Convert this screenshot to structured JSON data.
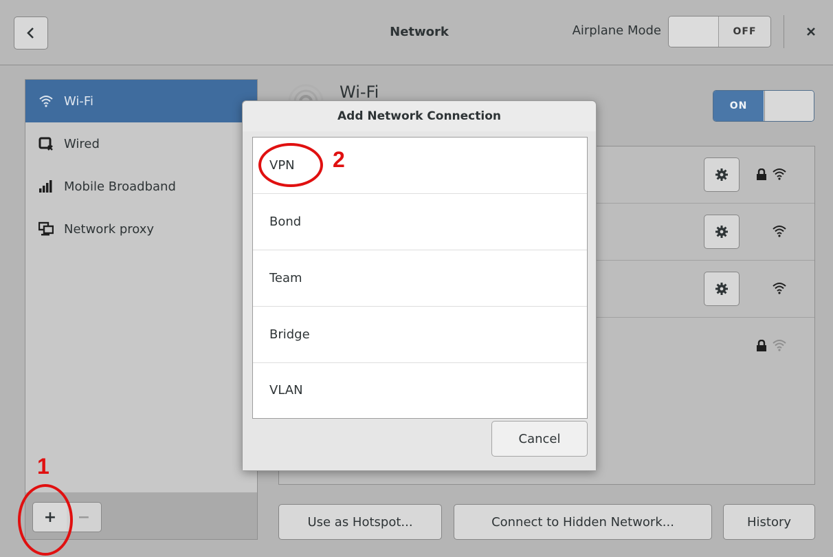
{
  "header": {
    "title": "Network",
    "airplane_label": "Airplane Mode",
    "airplane_state": "OFF"
  },
  "sidebar": {
    "items": [
      {
        "label": "Wi-Fi",
        "icon": "wifi-icon",
        "selected": true
      },
      {
        "label": "Wired",
        "icon": "wired-icon"
      },
      {
        "label": "Mobile Broadband",
        "icon": "signal-bars-icon"
      },
      {
        "label": "Network proxy",
        "icon": "proxy-icon"
      }
    ],
    "add_label": "+",
    "remove_label": "−"
  },
  "wifi_panel": {
    "title": "Wi-Fi",
    "power_state": "ON",
    "networks": [
      {
        "locked": true,
        "has_settings": true
      },
      {
        "locked": false,
        "has_settings": true
      },
      {
        "locked": false,
        "has_settings": true
      },
      {
        "locked": true,
        "has_settings": false,
        "weak": true
      }
    ]
  },
  "actions": {
    "hotspot": "Use as Hotspot...",
    "hidden": "Connect to Hidden Network...",
    "history": "History"
  },
  "dialog": {
    "title": "Add Network Connection",
    "options": [
      "VPN",
      "Bond",
      "Team",
      "Bridge",
      "VLAN"
    ],
    "cancel": "Cancel"
  },
  "annotations": {
    "step1": "1",
    "step2": "2",
    "color": "#e01010"
  },
  "colors": {
    "accent": "#3f6c9e",
    "switch_on": "#4a77a8"
  }
}
